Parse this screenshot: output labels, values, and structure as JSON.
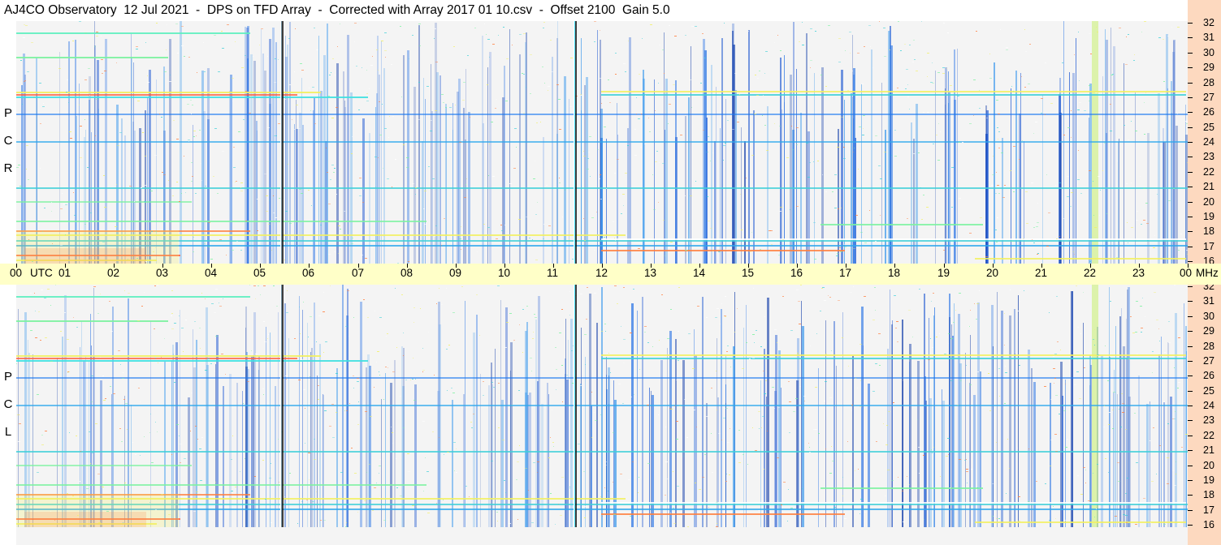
{
  "title": "AJ4CO Observatory  12 Jul 2021  -  DPS on TFD Array  -  Corrected with Array 2017 01 10.csv  -  Offset 2100  Gain 5.0",
  "panels": [
    {
      "id": "rcp",
      "label_letters": [
        "P",
        "C",
        "R"
      ]
    },
    {
      "id": "lcp",
      "label_letters": [
        "P",
        "C",
        "L"
      ]
    }
  ],
  "time_axis": {
    "labels": [
      "00",
      "01",
      "02",
      "03",
      "04",
      "05",
      "06",
      "07",
      "08",
      "09",
      "10",
      "11",
      "12",
      "13",
      "14",
      "15",
      "16",
      "17",
      "18",
      "19",
      "20",
      "21",
      "22",
      "23",
      "00"
    ],
    "utc_label": "UTC",
    "unit_label": "MHz"
  },
  "freq_axis": {
    "labels": [
      "32",
      "31",
      "30",
      "29",
      "28",
      "27",
      "26",
      "25",
      "24",
      "23",
      "22",
      "21",
      "20",
      "19",
      "18",
      "17",
      "16"
    ]
  },
  "colors": {
    "title_bg": "#ffffff",
    "time_bar_bg": "#ffffc8",
    "freq_axis_bg": "#fdd9bf",
    "colormap": [
      "#000000",
      "#000b33",
      "#002b88",
      "#0050d8",
      "#1a78f0",
      "#2ea8ec",
      "#3fd0d8",
      "#7cf2a0",
      "#f2f060",
      "#ff8040",
      "#ff3030"
    ]
  }
}
